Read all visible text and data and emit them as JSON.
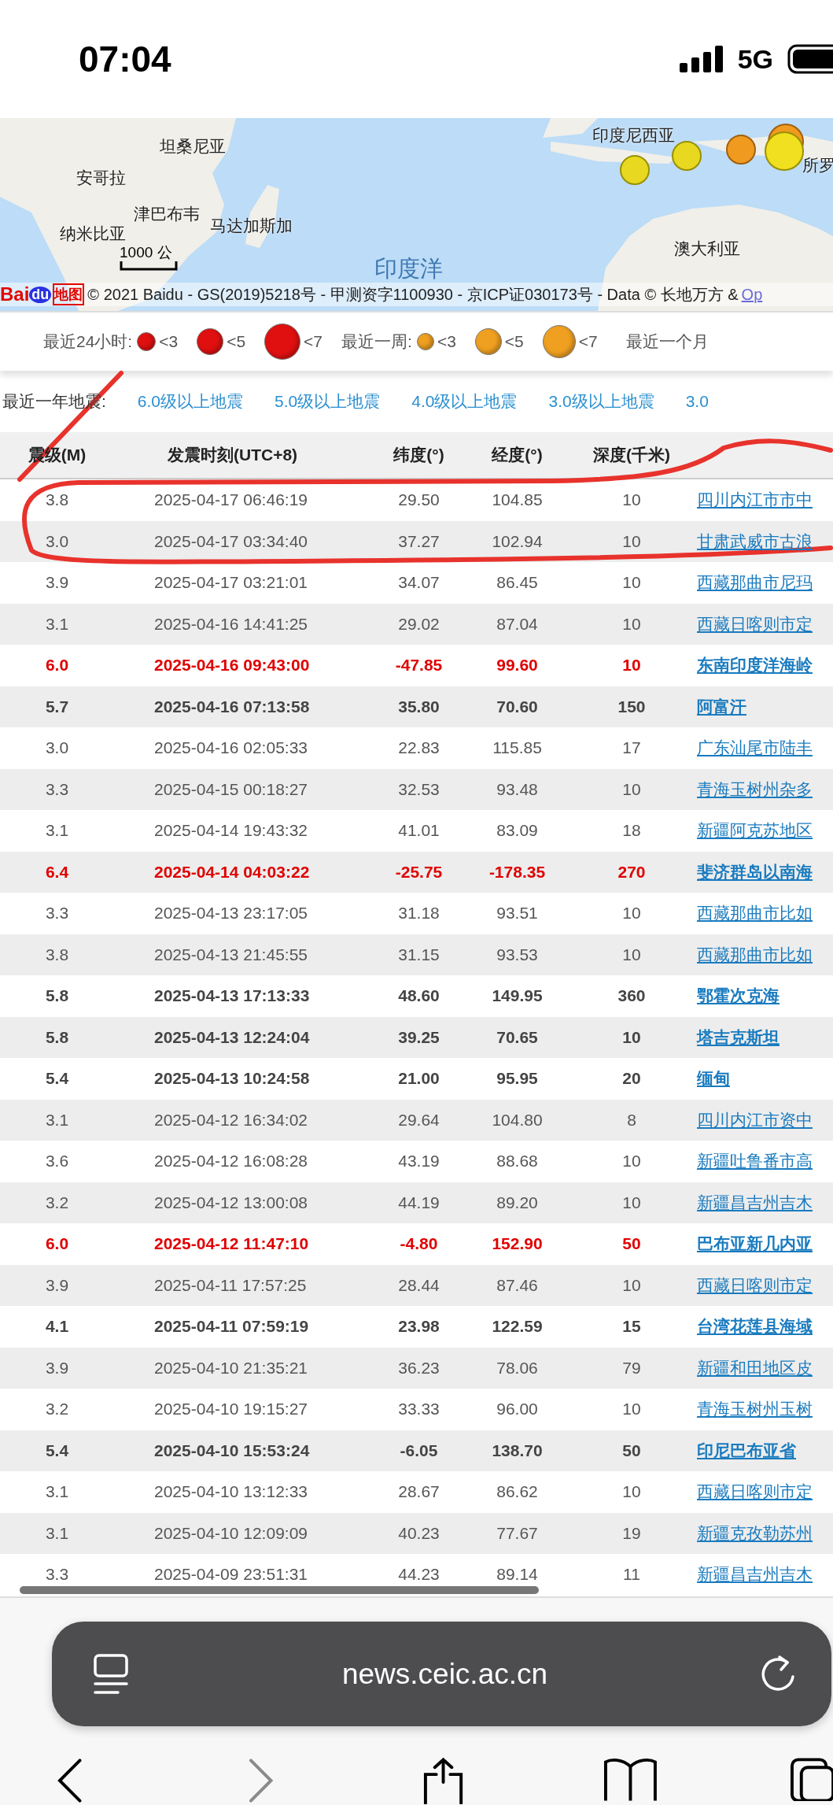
{
  "status_bar": {
    "time": "07:04",
    "network": "5G"
  },
  "map": {
    "labels": [
      "坦桑尼亚",
      "安哥拉",
      "津巴布韦",
      "纳米比亚",
      "马达加斯加",
      "印度尼西亚",
      "澳大利亚",
      "所罗"
    ],
    "ocean_label": "印度洋",
    "scale_label": "1000 公",
    "logo": {
      "part_1": "Bai",
      "part_2": "du",
      "part_3": "地图"
    },
    "copyright": "© 2021 Baidu - GS(2019)5218号 - 甲测资字1100930 - 京ICP证030173号 - Data © 长地万方 &",
    "copyright_link": "Op"
  },
  "legend": {
    "groups": [
      {
        "label": "最近24小时:",
        "color": "#e01010",
        "items": [
          "<3",
          "<5",
          "<7"
        ]
      },
      {
        "label": "最近一周:",
        "color": "#f0a020",
        "items": [
          "<3",
          "<5",
          "<7"
        ]
      }
    ],
    "cut_label": "最近一个月"
  },
  "filter": {
    "label": "最近一年地震:",
    "links": [
      "6.0级以上地震",
      "5.0级以上地震",
      "4.0级以上地震",
      "3.0级以上地震",
      "3.0"
    ]
  },
  "table": {
    "columns": [
      "震级(M)",
      "发震时刻(UTC+8)",
      "纬度(°)",
      "经度(°)",
      "深度(千米)"
    ],
    "rows": [
      {
        "kind": "normal",
        "mag": "3.8",
        "time": "2025-04-17 06:46:19",
        "lat": "29.50",
        "lon": "104.85",
        "depth": "10",
        "place": "四川内江市市中"
      },
      {
        "kind": "normal",
        "mag": "3.0",
        "time": "2025-04-17 03:34:40",
        "lat": "37.27",
        "lon": "102.94",
        "depth": "10",
        "place": "甘肃武威市古浪"
      },
      {
        "kind": "normal",
        "mag": "3.9",
        "time": "2025-04-17 03:21:01",
        "lat": "34.07",
        "lon": "86.45",
        "depth": "10",
        "place": "西藏那曲市尼玛"
      },
      {
        "kind": "normal",
        "mag": "3.1",
        "time": "2025-04-16 14:41:25",
        "lat": "29.02",
        "lon": "87.04",
        "depth": "10",
        "place": "西藏日喀则市定"
      },
      {
        "kind": "major",
        "mag": "6.0",
        "time": "2025-04-16 09:43:00",
        "lat": "-47.85",
        "lon": "99.60",
        "depth": "10",
        "place": "东南印度洋海岭"
      },
      {
        "kind": "strong",
        "mag": "5.7",
        "time": "2025-04-16 07:13:58",
        "lat": "35.80",
        "lon": "70.60",
        "depth": "150",
        "place": "阿富汗"
      },
      {
        "kind": "normal",
        "mag": "3.0",
        "time": "2025-04-16 02:05:33",
        "lat": "22.83",
        "lon": "115.85",
        "depth": "17",
        "place": "广东汕尾市陆丰"
      },
      {
        "kind": "normal",
        "mag": "3.3",
        "time": "2025-04-15 00:18:27",
        "lat": "32.53",
        "lon": "93.48",
        "depth": "10",
        "place": "青海玉树州杂多"
      },
      {
        "kind": "normal",
        "mag": "3.1",
        "time": "2025-04-14 19:43:32",
        "lat": "41.01",
        "lon": "83.09",
        "depth": "18",
        "place": "新疆阿克苏地区"
      },
      {
        "kind": "major",
        "mag": "6.4",
        "time": "2025-04-14 04:03:22",
        "lat": "-25.75",
        "lon": "-178.35",
        "depth": "270",
        "place": "斐济群岛以南海"
      },
      {
        "kind": "normal",
        "mag": "3.3",
        "time": "2025-04-13 23:17:05",
        "lat": "31.18",
        "lon": "93.51",
        "depth": "10",
        "place": "西藏那曲市比如"
      },
      {
        "kind": "normal",
        "mag": "3.8",
        "time": "2025-04-13 21:45:55",
        "lat": "31.15",
        "lon": "93.53",
        "depth": "10",
        "place": "西藏那曲市比如"
      },
      {
        "kind": "strong",
        "mag": "5.8",
        "time": "2025-04-13 17:13:33",
        "lat": "48.60",
        "lon": "149.95",
        "depth": "360",
        "place": "鄂霍次克海"
      },
      {
        "kind": "strong",
        "mag": "5.8",
        "time": "2025-04-13 12:24:04",
        "lat": "39.25",
        "lon": "70.65",
        "depth": "10",
        "place": "塔吉克斯坦"
      },
      {
        "kind": "strong",
        "mag": "5.4",
        "time": "2025-04-13 10:24:58",
        "lat": "21.00",
        "lon": "95.95",
        "depth": "20",
        "place": "缅甸"
      },
      {
        "kind": "normal",
        "mag": "3.1",
        "time": "2025-04-12 16:34:02",
        "lat": "29.64",
        "lon": "104.80",
        "depth": "8",
        "place": "四川内江市资中"
      },
      {
        "kind": "normal",
        "mag": "3.6",
        "time": "2025-04-12 16:08:28",
        "lat": "43.19",
        "lon": "88.68",
        "depth": "10",
        "place": "新疆吐鲁番市高"
      },
      {
        "kind": "normal",
        "mag": "3.2",
        "time": "2025-04-12 13:00:08",
        "lat": "44.19",
        "lon": "89.20",
        "depth": "10",
        "place": "新疆昌吉州吉木"
      },
      {
        "kind": "major",
        "mag": "6.0",
        "time": "2025-04-12 11:47:10",
        "lat": "-4.80",
        "lon": "152.90",
        "depth": "50",
        "place": "巴布亚新几内亚"
      },
      {
        "kind": "normal",
        "mag": "3.9",
        "time": "2025-04-11 17:57:25",
        "lat": "28.44",
        "lon": "87.46",
        "depth": "10",
        "place": "西藏日喀则市定"
      },
      {
        "kind": "strong",
        "mag": "4.1",
        "time": "2025-04-11 07:59:19",
        "lat": "23.98",
        "lon": "122.59",
        "depth": "15",
        "place": "台湾花莲县海域"
      },
      {
        "kind": "normal",
        "mag": "3.9",
        "time": "2025-04-10 21:35:21",
        "lat": "36.23",
        "lon": "78.06",
        "depth": "79",
        "place": "新疆和田地区皮"
      },
      {
        "kind": "normal",
        "mag": "3.2",
        "time": "2025-04-10 19:15:27",
        "lat": "33.33",
        "lon": "96.00",
        "depth": "10",
        "place": "青海玉树州玉树"
      },
      {
        "kind": "strong",
        "mag": "5.4",
        "time": "2025-04-10 15:53:24",
        "lat": "-6.05",
        "lon": "138.70",
        "depth": "50",
        "place": "印尼巴布亚省"
      },
      {
        "kind": "normal",
        "mag": "3.1",
        "time": "2025-04-10 13:12:33",
        "lat": "28.67",
        "lon": "86.62",
        "depth": "10",
        "place": "西藏日喀则市定"
      },
      {
        "kind": "normal",
        "mag": "3.1",
        "time": "2025-04-10 12:09:09",
        "lat": "40.23",
        "lon": "77.67",
        "depth": "19",
        "place": "新疆克孜勒苏州"
      },
      {
        "kind": "normal",
        "mag": "3.3",
        "time": "2025-04-09 23:51:31",
        "lat": "44.23",
        "lon": "89.14",
        "depth": "11",
        "place": "新疆昌吉州吉木"
      }
    ]
  },
  "browser": {
    "url": "news.ceic.ac.cn"
  }
}
